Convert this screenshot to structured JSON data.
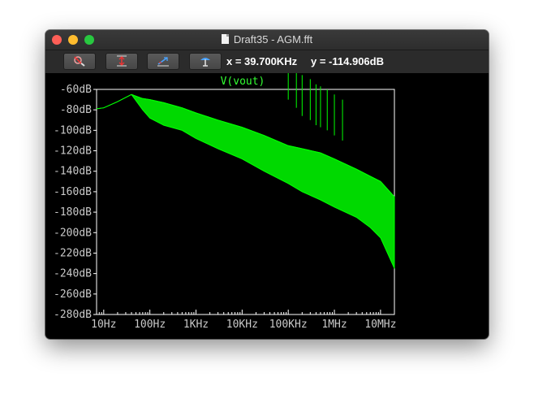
{
  "window": {
    "title": "Draft35 - AGM.fft"
  },
  "toolbar": {
    "buttons": [
      {
        "name": "zoom-cancel",
        "icon": "magnifier-cancel-icon"
      },
      {
        "name": "autorange-y",
        "icon": "autorange-vertical-icon"
      },
      {
        "name": "autorange-x",
        "icon": "autorange-horizontal-icon"
      },
      {
        "name": "mark-text",
        "icon": "anchor-text-icon"
      }
    ],
    "cursor_x": "x = 39.700KHz",
    "cursor_y": "y = -114.906dB"
  },
  "colors": {
    "trace": "#00ff00",
    "background": "#000000",
    "grid": "#ffffff",
    "labels": "#c9c9c9"
  },
  "chart_data": {
    "type": "line",
    "title": "V(vout)",
    "xscale": "log",
    "xlim": [
      7,
      20000000
    ],
    "ylim": [
      -280,
      -60
    ],
    "yticks": [
      "-60dB",
      "-80dB",
      "-100dB",
      "-120dB",
      "-140dB",
      "-160dB",
      "-180dB",
      "-200dB",
      "-220dB",
      "-240dB",
      "-260dB",
      "-280dB"
    ],
    "xticks": [
      "10Hz",
      "100Hz",
      "1KHz",
      "10KHz",
      "100KHz",
      "1MHz",
      "10MHz"
    ],
    "grid": false,
    "series": [
      {
        "name": "V(vout)",
        "envelope_upper": [
          [
            7,
            -79
          ],
          [
            10,
            -78
          ],
          [
            20,
            -72
          ],
          [
            40,
            -65
          ],
          [
            70,
            -69
          ],
          [
            100,
            -70
          ],
          [
            200,
            -73
          ],
          [
            500,
            -78
          ],
          [
            1000,
            -83
          ],
          [
            3000,
            -90
          ],
          [
            10000,
            -97
          ],
          [
            30000,
            -105
          ],
          [
            100000,
            -115
          ],
          [
            200000,
            -118
          ],
          [
            500000,
            -122
          ],
          [
            1000000,
            -128
          ],
          [
            3000000,
            -138
          ],
          [
            6000000,
            -145
          ],
          [
            10000000,
            -150
          ],
          [
            20000000,
            -165
          ]
        ],
        "envelope_lower": [
          [
            7,
            -79
          ],
          [
            10,
            -78
          ],
          [
            20,
            -72
          ],
          [
            40,
            -65
          ],
          [
            70,
            -80
          ],
          [
            100,
            -88
          ],
          [
            200,
            -95
          ],
          [
            500,
            -100
          ],
          [
            1000,
            -108
          ],
          [
            3000,
            -118
          ],
          [
            10000,
            -128
          ],
          [
            30000,
            -140
          ],
          [
            100000,
            -152
          ],
          [
            200000,
            -160
          ],
          [
            500000,
            -168
          ],
          [
            1000000,
            -175
          ],
          [
            3000000,
            -185
          ],
          [
            6000000,
            -195
          ],
          [
            10000000,
            -205
          ],
          [
            20000000,
            -235
          ]
        ],
        "spikes": [
          [
            100000,
            -70
          ],
          [
            150000,
            -78
          ],
          [
            200000,
            -86
          ],
          [
            300000,
            -90
          ],
          [
            400000,
            -95
          ],
          [
            500000,
            -97
          ],
          [
            700000,
            -100
          ],
          [
            1000000,
            -105
          ],
          [
            1500000,
            -110
          ]
        ]
      }
    ]
  }
}
